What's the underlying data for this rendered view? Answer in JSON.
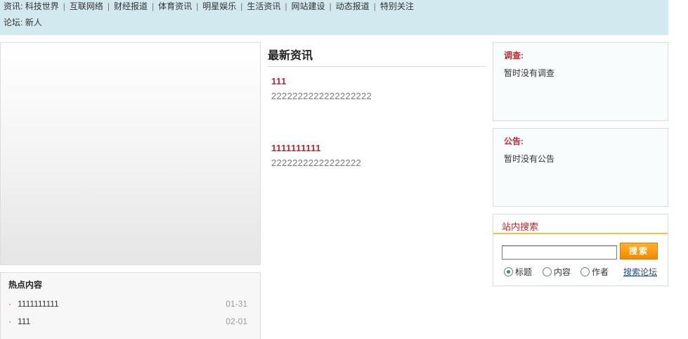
{
  "nav": {
    "news_label": "资讯:",
    "news_links": [
      "科技世界",
      "互联网络",
      "财经报道",
      "体育资讯",
      "明星娱乐",
      "生活资讯",
      "网站建设",
      "动态报道",
      "特别关注"
    ],
    "forum_label": "论坛:",
    "forum_links": [
      "新人"
    ]
  },
  "hot": {
    "title": "热点内容",
    "items": [
      {
        "text": "1111111111",
        "date": "01-31"
      },
      {
        "text": "111",
        "date": "02-01"
      }
    ]
  },
  "latest": {
    "title": "最新资讯",
    "items": [
      {
        "title": "111",
        "body": "2222222222222222222"
      },
      {
        "title": "1111111111",
        "body": "22222222222222222"
      }
    ]
  },
  "survey": {
    "title": "调查:",
    "content": "暂时没有调查"
  },
  "notice": {
    "title": "公告:",
    "content": "暂时没有公告"
  },
  "search": {
    "title": "站内搜索",
    "input_value": "",
    "button_label": "搜索",
    "options": [
      {
        "label": "标题",
        "selected": true
      },
      {
        "label": "内容",
        "selected": false
      },
      {
        "label": "作者",
        "selected": false
      }
    ],
    "forum_link": "搜索论坛"
  },
  "colors": {
    "accent_red": "#c0282e",
    "header_bg": "#d2e9ef",
    "search_button": "#f08a00"
  }
}
